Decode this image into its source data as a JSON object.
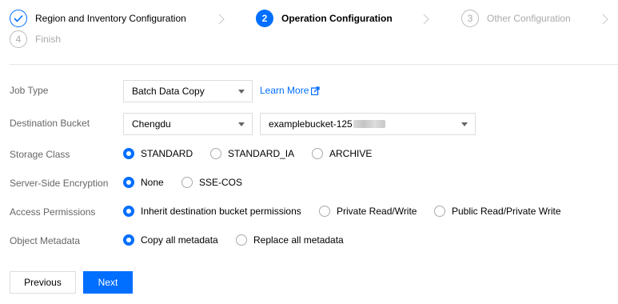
{
  "steps": [
    {
      "label": "Region and Inventory Configuration",
      "state": "done",
      "number": ""
    },
    {
      "label": "Operation Configuration",
      "state": "active",
      "number": "2"
    },
    {
      "label": "Other Configuration",
      "state": "todo",
      "number": "3"
    },
    {
      "label": "Finish",
      "state": "todo",
      "number": "4"
    }
  ],
  "form": {
    "job_type": {
      "label": "Job Type",
      "value": "Batch Data Copy",
      "learn_more": "Learn More"
    },
    "destination_bucket": {
      "label": "Destination Bucket",
      "region": "Chengdu",
      "bucket": "examplebucket-125"
    },
    "storage_class": {
      "label": "Storage Class",
      "options": [
        "STANDARD",
        "STANDARD_IA",
        "ARCHIVE"
      ],
      "selected": "STANDARD"
    },
    "encryption": {
      "label": "Server-Side Encryption",
      "options": [
        "None",
        "SSE-COS"
      ],
      "selected": "None"
    },
    "access": {
      "label": "Access Permissions",
      "options": [
        "Inherit destination bucket permissions",
        "Private Read/Write",
        "Public Read/Private Write"
      ],
      "selected": "Inherit destination bucket permissions"
    },
    "metadata": {
      "label": "Object Metadata",
      "options": [
        "Copy all metadata",
        "Replace all metadata"
      ],
      "selected": "Copy all metadata"
    }
  },
  "buttons": {
    "previous": "Previous",
    "next": "Next"
  },
  "colors": {
    "accent": "#006eff",
    "label": "#666666",
    "muted": "#aaaaaa",
    "border": "#dddddd"
  }
}
